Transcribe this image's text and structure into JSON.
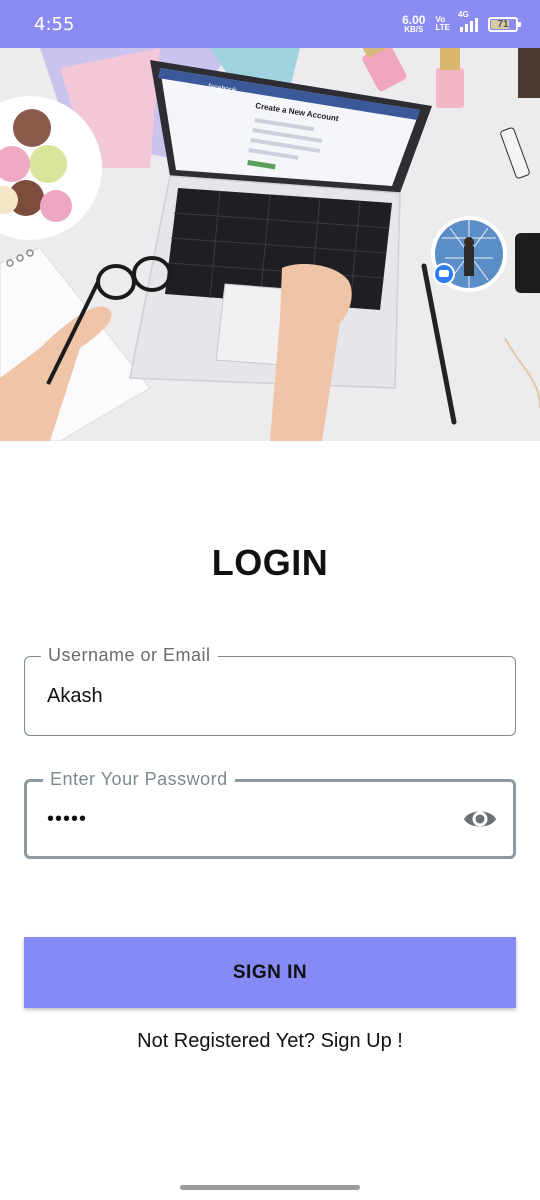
{
  "status_bar": {
    "time": "4:55",
    "net_speed": "6.00",
    "net_unit": "KB/S",
    "volte_top": "Vo",
    "volte_bottom": "LTE",
    "network": "4G",
    "battery": "71",
    "background_color": "#8a8cf2"
  },
  "hero": {
    "laptop_screen_brand": "facebook",
    "laptop_screen_heading": "Create a New Account"
  },
  "login": {
    "title": "LOGIN",
    "username": {
      "label": "Username or Email",
      "value": "Akash"
    },
    "password": {
      "label": "Enter Your Password",
      "value": "•••••",
      "toggle_icon": "eye-icon"
    },
    "sign_in_label": "SIGN IN",
    "signup_text": "Not Registered Yet? Sign Up !",
    "accent_color": "#858af5"
  }
}
